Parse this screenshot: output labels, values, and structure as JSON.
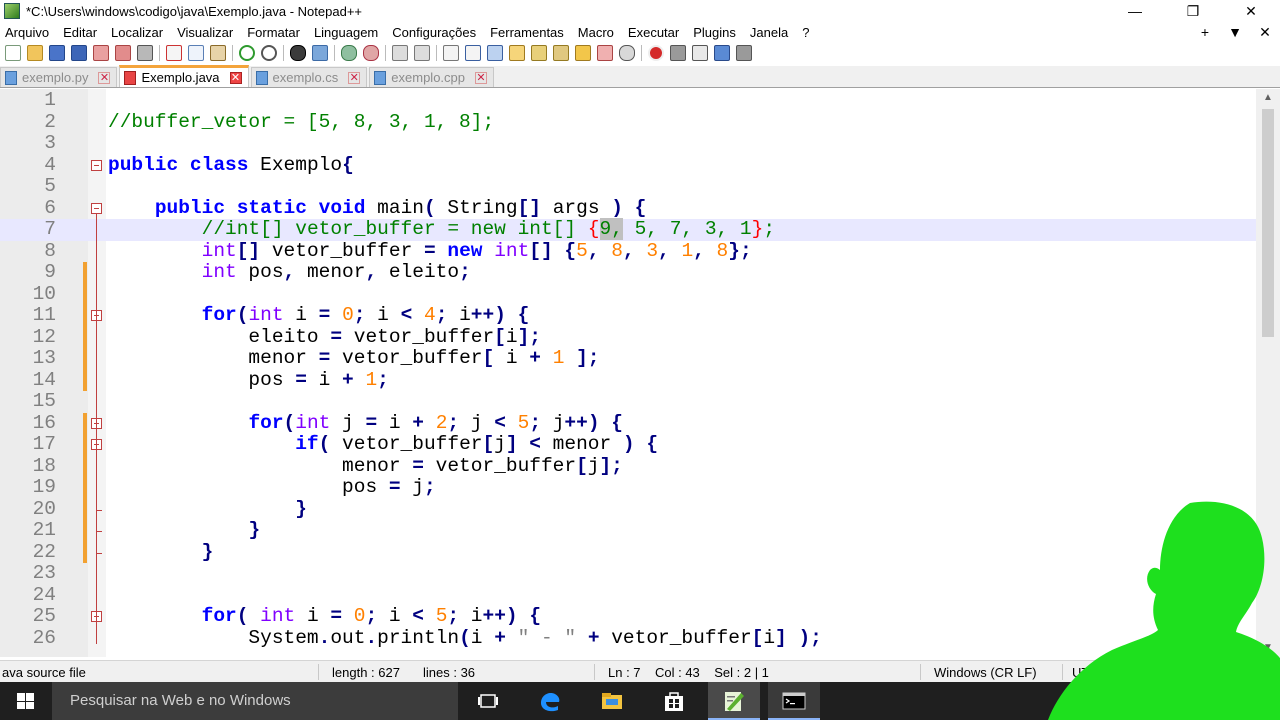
{
  "window": {
    "title": "*C:\\Users\\windows\\codigo\\java\\Exemplo.java - Notepad++",
    "minimize_glyph": "—",
    "maximize_glyph": "❐",
    "close_glyph": "✕"
  },
  "menu": {
    "items": [
      "Arquivo",
      "Editar",
      "Localizar",
      "Visualizar",
      "Formatar",
      "Linguagem",
      "Configurações",
      "Ferramentas",
      "Macro",
      "Executar",
      "Plugins",
      "Janela",
      "?"
    ],
    "right": [
      "+",
      "▼",
      "✕"
    ]
  },
  "tabs": [
    {
      "label": "exemplo.py",
      "active": false
    },
    {
      "label": "Exemplo.java",
      "active": true
    },
    {
      "label": "exemplo.cs",
      "active": false
    },
    {
      "label": "exemplo.cpp",
      "active": false
    }
  ],
  "editor": {
    "current_line": 7,
    "lines": [
      {
        "n": "1",
        "html": ""
      },
      {
        "n": "2",
        "html": "<span class=\"cm\">//buffer_vetor = [5, 8, 3, 1, 8];</span>"
      },
      {
        "n": "3",
        "html": ""
      },
      {
        "n": "4",
        "html": "<span class=\"kw\">public</span> <span class=\"kw\">class</span> Exemplo<span class=\"op\">{</span>"
      },
      {
        "n": "5",
        "html": ""
      },
      {
        "n": "6",
        "html": "    <span class=\"kw\">public</span> <span class=\"kw\">static</span> <span class=\"kw\">void</span> main<span class=\"op\">(</span> String<span class=\"op\">[]</span> args <span class=\"op\">)</span> <span class=\"op\">{</span>"
      },
      {
        "n": "7",
        "html": "        <span class=\"cm\">//int[] vetor_buffer = new int[] </span><span class=\"brk\">{</span><span class=\"cm\"><span class=\"sel\">9,</span> 5, 7, 3, 1</span><span class=\"brk\">}</span><span class=\"cm\">;</span>"
      },
      {
        "n": "8",
        "html": "        <span class=\"ty\">int</span><span class=\"op\">[]</span> vetor_buffer <span class=\"op\">=</span> <span class=\"kw\">new</span> <span class=\"ty\">int</span><span class=\"op\">[]</span> <span class=\"op\">{</span><span class=\"num\">5</span><span class=\"op\">,</span> <span class=\"num\">8</span><span class=\"op\">,</span> <span class=\"num\">3</span><span class=\"op\">,</span> <span class=\"num\">1</span><span class=\"op\">,</span> <span class=\"num\">8</span><span class=\"op\">};</span>"
      },
      {
        "n": "9",
        "html": "        <span class=\"ty\">int</span> pos<span class=\"op\">,</span> menor<span class=\"op\">,</span> eleito<span class=\"op\">;</span>"
      },
      {
        "n": "10",
        "html": ""
      },
      {
        "n": "11",
        "html": "        <span class=\"kw\">for</span><span class=\"op\">(</span><span class=\"ty\">int</span> i <span class=\"op\">=</span> <span class=\"num\">0</span><span class=\"op\">;</span> i <span class=\"op\">&lt;</span> <span class=\"num\">4</span><span class=\"op\">;</span> i<span class=\"op\">++)</span> <span class=\"op\">{</span>"
      },
      {
        "n": "12",
        "html": "            eleito <span class=\"op\">=</span> vetor_buffer<span class=\"op\">[</span>i<span class=\"op\">];</span>"
      },
      {
        "n": "13",
        "html": "            menor <span class=\"op\">=</span> vetor_buffer<span class=\"op\">[</span> i <span class=\"op\">+</span> <span class=\"num\">1</span> <span class=\"op\">];</span>"
      },
      {
        "n": "14",
        "html": "            pos <span class=\"op\">=</span> i <span class=\"op\">+</span> <span class=\"num\">1</span><span class=\"op\">;</span>"
      },
      {
        "n": "15",
        "html": ""
      },
      {
        "n": "16",
        "html": "            <span class=\"kw\">for</span><span class=\"op\">(</span><span class=\"ty\">int</span> j <span class=\"op\">=</span> i <span class=\"op\">+</span> <span class=\"num\">2</span><span class=\"op\">;</span> j <span class=\"op\">&lt;</span> <span class=\"num\">5</span><span class=\"op\">;</span> j<span class=\"op\">++)</span> <span class=\"op\">{</span>"
      },
      {
        "n": "17",
        "html": "                <span class=\"kw\">if</span><span class=\"op\">(</span> vetor_buffer<span class=\"op\">[</span>j<span class=\"op\">]</span> <span class=\"op\">&lt;</span> menor <span class=\"op\">)</span> <span class=\"op\">{</span>"
      },
      {
        "n": "18",
        "html": "                    menor <span class=\"op\">=</span> vetor_buffer<span class=\"op\">[</span>j<span class=\"op\">];</span>"
      },
      {
        "n": "19",
        "html": "                    pos <span class=\"op\">=</span> j<span class=\"op\">;</span>"
      },
      {
        "n": "20",
        "html": "                <span class=\"op\">}</span>"
      },
      {
        "n": "21",
        "html": "            <span class=\"op\">}</span>"
      },
      {
        "n": "22",
        "html": "        <span class=\"op\">}</span>"
      },
      {
        "n": "23",
        "html": ""
      },
      {
        "n": "24",
        "html": ""
      },
      {
        "n": "25",
        "html": "        <span class=\"kw\">for</span><span class=\"op\">(</span> <span class=\"ty\">int</span> i <span class=\"op\">=</span> <span class=\"num\">0</span><span class=\"op\">;</span> i <span class=\"op\">&lt;</span> <span class=\"num\">5</span><span class=\"op\">;</span> i<span class=\"op\">++)</span> <span class=\"op\">{</span>"
      },
      {
        "n": "26",
        "html": "            System<span class=\"op\">.</span>out<span class=\"op\">.</span>println<span class=\"op\">(</span>i <span class=\"op\">+</span> <span class=\"str\">\" - \"</span> <span class=\"op\">+</span> vetor_buffer<span class=\"op\">[</span>i<span class=\"op\">]</span> <span class=\"op\">);</span>"
      }
    ]
  },
  "status": {
    "file_type": "ava source file",
    "length": "length : 627",
    "lines": "lines : 36",
    "position": "Ln : 7    Col : 43    Sel : 2 | 1",
    "eol": "Windows (CR LF)",
    "encoding": "UT"
  },
  "taskbar": {
    "search_placeholder": "Pesquisar na Web e no Windows"
  },
  "colors": {
    "comment": "#008000",
    "keyword": "#0000ff",
    "type": "#8000ff",
    "number": "#ff8000",
    "operator": "#000080",
    "current_line": "#e8e8ff",
    "overlay_green": "#1ee01e"
  }
}
